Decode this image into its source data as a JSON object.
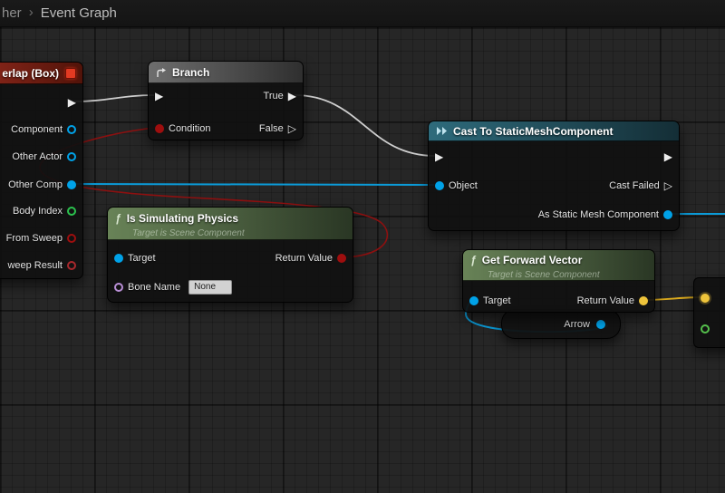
{
  "breadcrumb": {
    "parent": "her",
    "separator": "›",
    "current": "Event Graph"
  },
  "icons": {
    "exec_filled": "▶",
    "exec_hollow": "▷",
    "function_glyph": "ƒ"
  },
  "nodes": {
    "event_overlap": {
      "title": "erlap (Box)",
      "pins": {
        "component": "Component",
        "other_actor": "Other Actor",
        "other_comp": "Other Comp",
        "body_index": "Body Index",
        "from_sweep": "From Sweep",
        "sweep_result": "weep Result"
      }
    },
    "branch": {
      "title": "Branch",
      "condition": "Condition",
      "true_label": "True",
      "false_label": "False"
    },
    "cast": {
      "title": "Cast To StaticMeshComponent",
      "object": "Object",
      "cast_failed": "Cast Failed",
      "as_static_mesh": "As Static Mesh Component"
    },
    "is_simulating_physics": {
      "title": "Is Simulating Physics",
      "subtitle": "Target is Scene Component",
      "target": "Target",
      "return_value": "Return Value",
      "bone_name": "Bone Name",
      "bone_name_value": "None"
    },
    "get_forward_vector": {
      "title": "Get Forward Vector",
      "subtitle": "Target is Scene Component",
      "target": "Target",
      "return_value": "Return Value"
    },
    "arrow": {
      "label": "Arrow"
    }
  },
  "colors": {
    "object_pin": "#00a2e8",
    "bool_pin": "#9e0e0e",
    "int_pin": "#2bc24e",
    "vector_pin": "#eec43b",
    "float_pin": "#55c04c",
    "name_pin": "#b98fd6",
    "exec_wire": "#cfcfcf"
  }
}
